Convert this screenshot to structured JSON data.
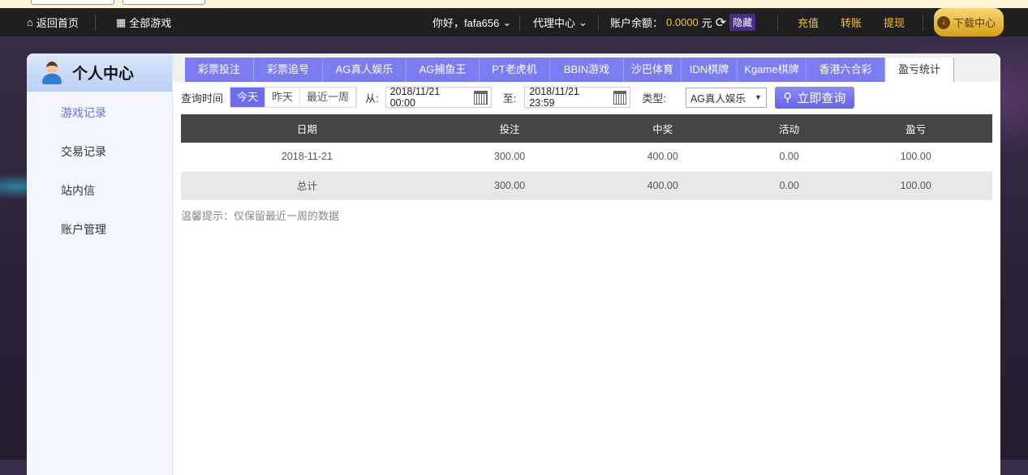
{
  "nav": {
    "home": "返回首页",
    "all_games": "全部游戏",
    "greeting": "你好，fafa656",
    "agent": "代理中心",
    "balance_label": "账户余额：",
    "balance": "0.0000",
    "currency": "元",
    "hide": "隐藏",
    "deposit": "充值",
    "transfer": "转账",
    "withdraw": "提现",
    "download": "下载中心"
  },
  "sidebar": {
    "title": "个人中心",
    "items": [
      {
        "label": "游戏记录"
      },
      {
        "label": "交易记录"
      },
      {
        "label": "站内信"
      },
      {
        "label": "账户管理"
      }
    ]
  },
  "tabs": [
    {
      "label": "彩票投注"
    },
    {
      "label": "彩票追号"
    },
    {
      "label": "AG真人娱乐"
    },
    {
      "label": "AG捕鱼王"
    },
    {
      "label": "PT老虎机"
    },
    {
      "label": "BBIN游戏"
    },
    {
      "label": "沙巴体育"
    },
    {
      "label": "IDN棋牌"
    },
    {
      "label": "Kgame棋牌"
    },
    {
      "label": "香港六合彩"
    },
    {
      "label": "盈亏统计"
    }
  ],
  "query": {
    "time_label": "查询时间",
    "today": "今天",
    "yesterday": "昨天",
    "week": "最近一周",
    "from_label": "从:",
    "from": "2018/11/21 00:00",
    "to_label": "至:",
    "to": "2018/11/21 23:59",
    "type_label": "类型:",
    "type": "AG真人娱乐",
    "submit": "立即查询"
  },
  "table": {
    "headers": [
      "日期",
      "投注",
      "中奖",
      "活动",
      "盈亏"
    ],
    "rows": [
      [
        "2018-11-21",
        "300.00",
        "400.00",
        "0.00",
        "100.00"
      ]
    ],
    "total": [
      "总计",
      "300.00",
      "400.00",
      "0.00",
      "100.00"
    ]
  },
  "tip": "温馨提示：仅保留最近一周的数据"
}
